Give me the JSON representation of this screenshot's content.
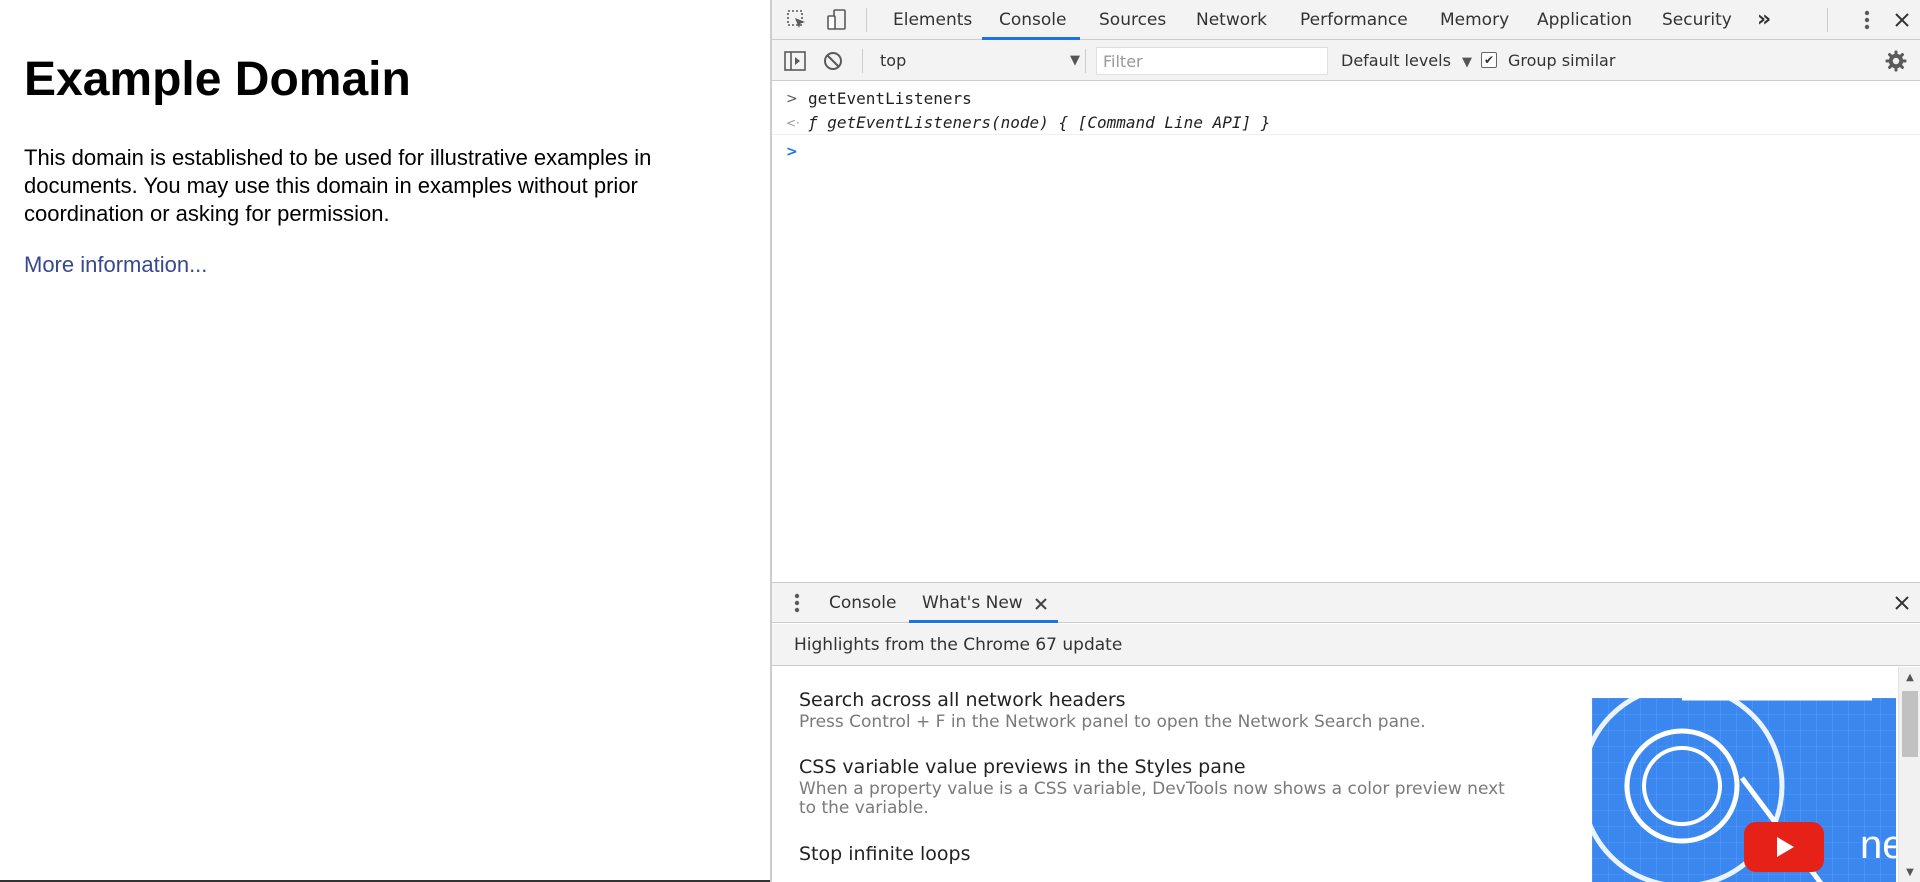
{
  "page": {
    "heading": "Example Domain",
    "paragraph": "This domain is established to be used for illustrative examples in documents. You may use this domain in examples without prior coordination or asking for permission.",
    "link": "More information..."
  },
  "devtools": {
    "tabs": [
      "Elements",
      "Console",
      "Sources",
      "Network",
      "Performance",
      "Memory",
      "Application",
      "Security"
    ],
    "active_tab": "Console",
    "overflow_label": "»",
    "console_toolbar": {
      "context": "top",
      "filter_placeholder": "Filter",
      "levels": "Default levels",
      "group_similar": "Group similar",
      "group_similar_checked": true
    },
    "console_lines": [
      {
        "type": "input",
        "marker": ">",
        "text": "getEventListeners"
      },
      {
        "type": "result",
        "marker": "<·",
        "text": "ƒ getEventListeners(node) { [Command Line API] }"
      },
      {
        "type": "prompt",
        "marker": ">",
        "text": ""
      }
    ],
    "drawer": {
      "tabs": [
        "Console",
        "What's New"
      ],
      "active_tab": "What's New",
      "header": "Highlights from the Chrome 67 update",
      "items": [
        {
          "title": "Search across all network headers",
          "desc": "Press Control + F in the Network panel to open the Network Search pane."
        },
        {
          "title": "CSS variable value previews in the Styles pane",
          "desc": "When a property value is a CSS variable, DevTools now shows a color preview next to the variable."
        },
        {
          "title": "Stop infinite loops",
          "desc": ""
        }
      ],
      "thumbnail_caption": "ne"
    }
  },
  "colors": {
    "accent": "#1a73e8",
    "link": "#38488f",
    "prompt": "#1a73e8",
    "toolbar_bg": "#f3f3f3"
  },
  "icons": [
    "inspect-icon",
    "device-toggle-icon",
    "more-tabs-icon",
    "kebab-menu-icon",
    "close-icon",
    "sidebar-toggle-icon",
    "clear-console-icon",
    "dropdown-arrow-icon",
    "settings-gear-icon",
    "checkbox-checked-icon",
    "drawer-menu-icon",
    "tab-close-icon",
    "play-button-icon"
  ]
}
